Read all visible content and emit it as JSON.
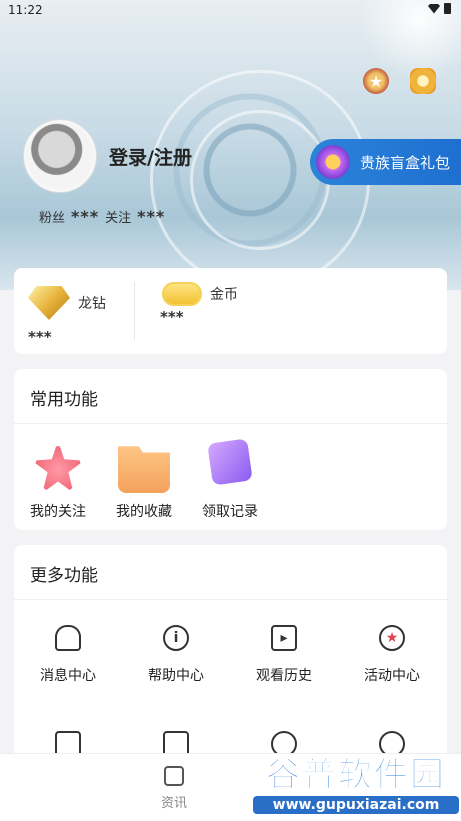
{
  "status_bar": {
    "time": "11:22"
  },
  "profile": {
    "login_label": "登录/注册",
    "fans_label": "粉丝",
    "fans_value": "***",
    "follow_label": "关注",
    "follow_value": "***"
  },
  "promo": {
    "label": "贵族盲盒礼包"
  },
  "wallet": {
    "diamond": {
      "label": "龙钻",
      "value": "***"
    },
    "gold": {
      "label": "金币",
      "value": "***"
    }
  },
  "common_functions": {
    "title": "常用功能",
    "items": [
      {
        "label": "我的关注",
        "icon": "star-icon"
      },
      {
        "label": "我的收藏",
        "icon": "folder-icon"
      },
      {
        "label": "领取记录",
        "icon": "record-icon"
      }
    ]
  },
  "more_functions": {
    "title": "更多功能",
    "items": [
      {
        "label": "消息中心",
        "icon": "bell-icon"
      },
      {
        "label": "帮助中心",
        "icon": "info-icon"
      },
      {
        "label": "观看历史",
        "icon": "play-doc-icon"
      },
      {
        "label": "活动中心",
        "icon": "star-circle-icon"
      }
    ]
  },
  "bottom_nav": {
    "tabs": [
      {
        "label": "资讯",
        "icon": "news-icon"
      }
    ]
  },
  "watermark": {
    "line1": "谷普软件园",
    "line2": "www.gupuxiazai.com"
  },
  "colors": {
    "promo_blue": "#2c84d9",
    "accent_red": "#e0404a"
  }
}
